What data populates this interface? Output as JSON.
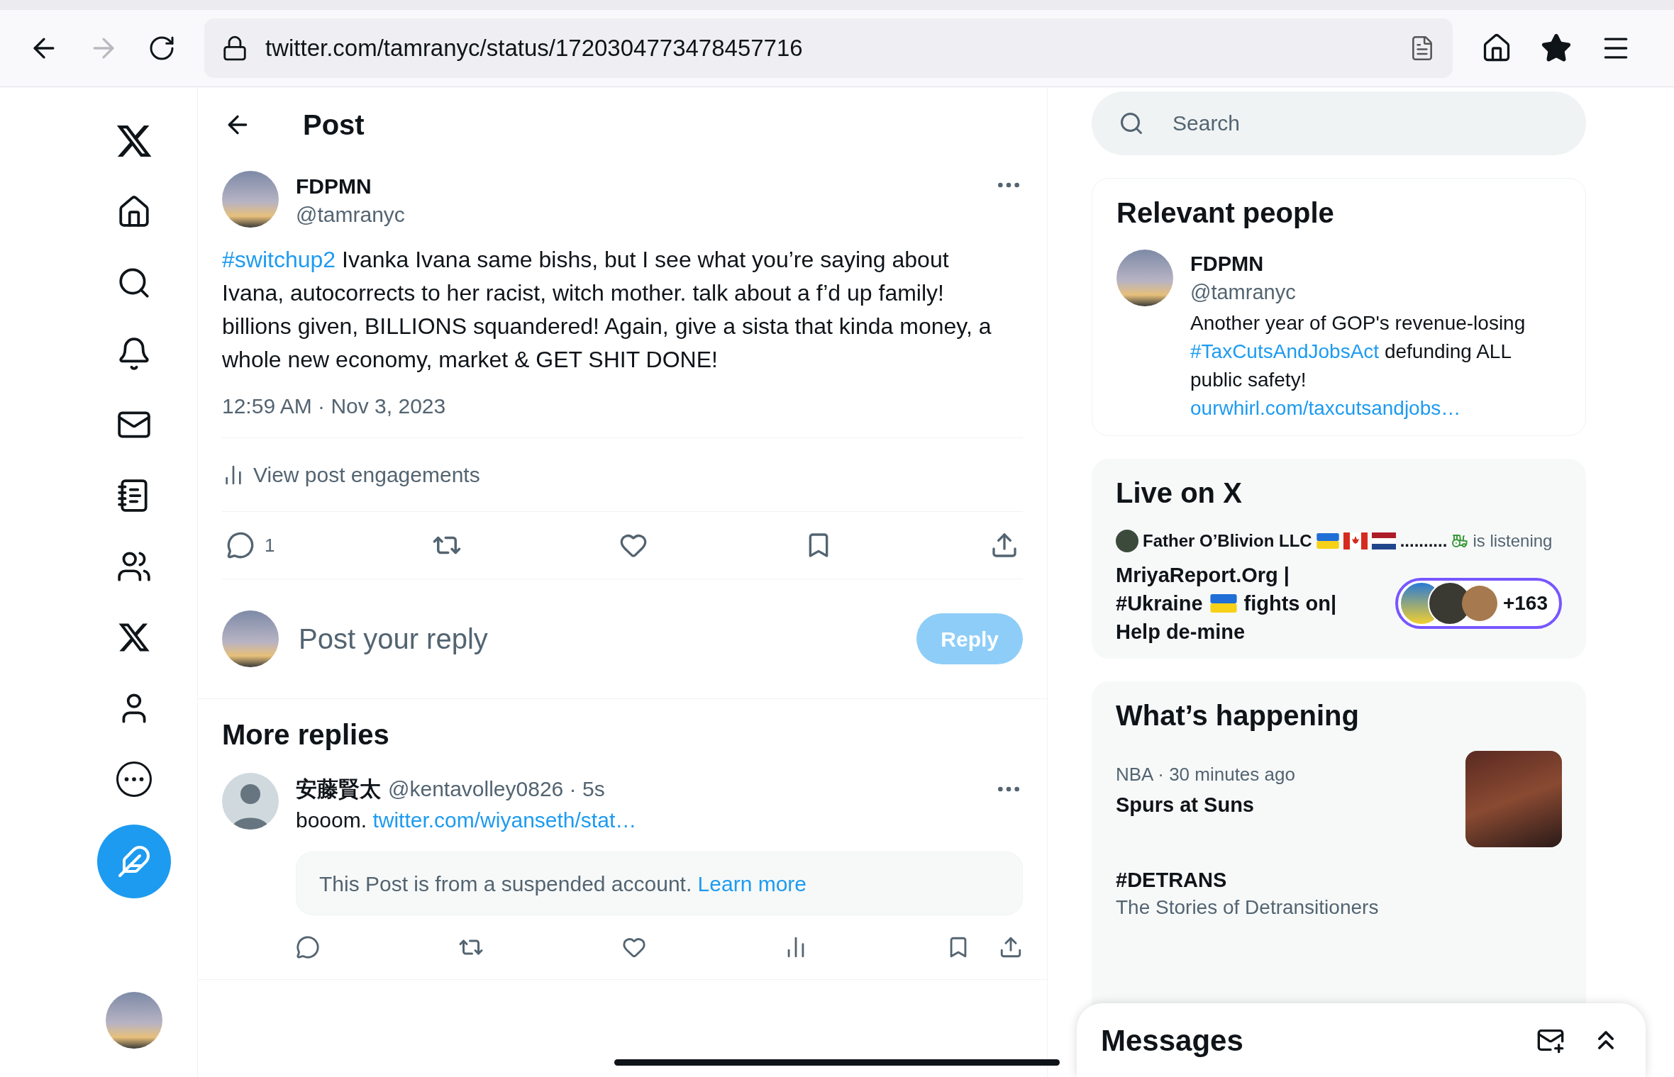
{
  "browser": {
    "url": "twitter.com/tamranyc/status/1720304773478457716"
  },
  "header": {
    "title": "Post"
  },
  "post": {
    "name": "FDPMN",
    "handle": "@tamranyc",
    "hashtag": "#switchup2",
    "text": "Ivanka Ivana same bishs, but I see what you’re saying about Ivana, autocorrects to her racist, witch mother. talk about a f’d up family! billions given, BILLIONS squandered! Again, give a sista that kinda money, a whole new economy, market & GET SHIT DONE!",
    "time": "12:59 AM · Nov 3, 2023",
    "engagements": "View post engagements",
    "reply_count": "1"
  },
  "composer": {
    "placeholder": "Post your reply",
    "button": "Reply",
    "disabled": true
  },
  "more_replies": {
    "title": "More replies",
    "replies": [
      {
        "name": "安藤賢太",
        "meta": "@kentavolley0826 · 5s",
        "text": "booom.",
        "link": "twitter.com/wiyanseth/stat…",
        "notice": "This Post is from a suspended account.",
        "notice_link": "Learn more"
      }
    ]
  },
  "search": {
    "placeholder": "Search"
  },
  "relevant_people": {
    "title": "Relevant people",
    "people": [
      {
        "name": "FDPMN",
        "handle": "@tamranyc",
        "bio_before": "Another year of GOP's revenue-losing",
        "bio_link": "#TaxCutsAndJobsAct",
        "bio_after": "defunding ALL public safety!",
        "url": "ourwhirl.com/taxcutsandjobs…"
      }
    ]
  },
  "live": {
    "title": "Live on X",
    "host": "Father O’Blivion LLC",
    "dots": "..........",
    "status": "is listening",
    "title_parts": [
      "MriyaReport.Org |",
      "#Ukraine",
      "fights on|",
      "Help de-mine"
    ],
    "listener_count": "+163"
  },
  "happening": {
    "title": "What’s happening",
    "trends": [
      {
        "kind": "image",
        "meta": "NBA · 30 minutes ago",
        "title": "Spurs at Suns"
      },
      {
        "kind": "text",
        "title": "#DETRANS",
        "subtitle": "The Stories of Detransitioners"
      }
    ]
  },
  "messages": {
    "title": "Messages"
  }
}
